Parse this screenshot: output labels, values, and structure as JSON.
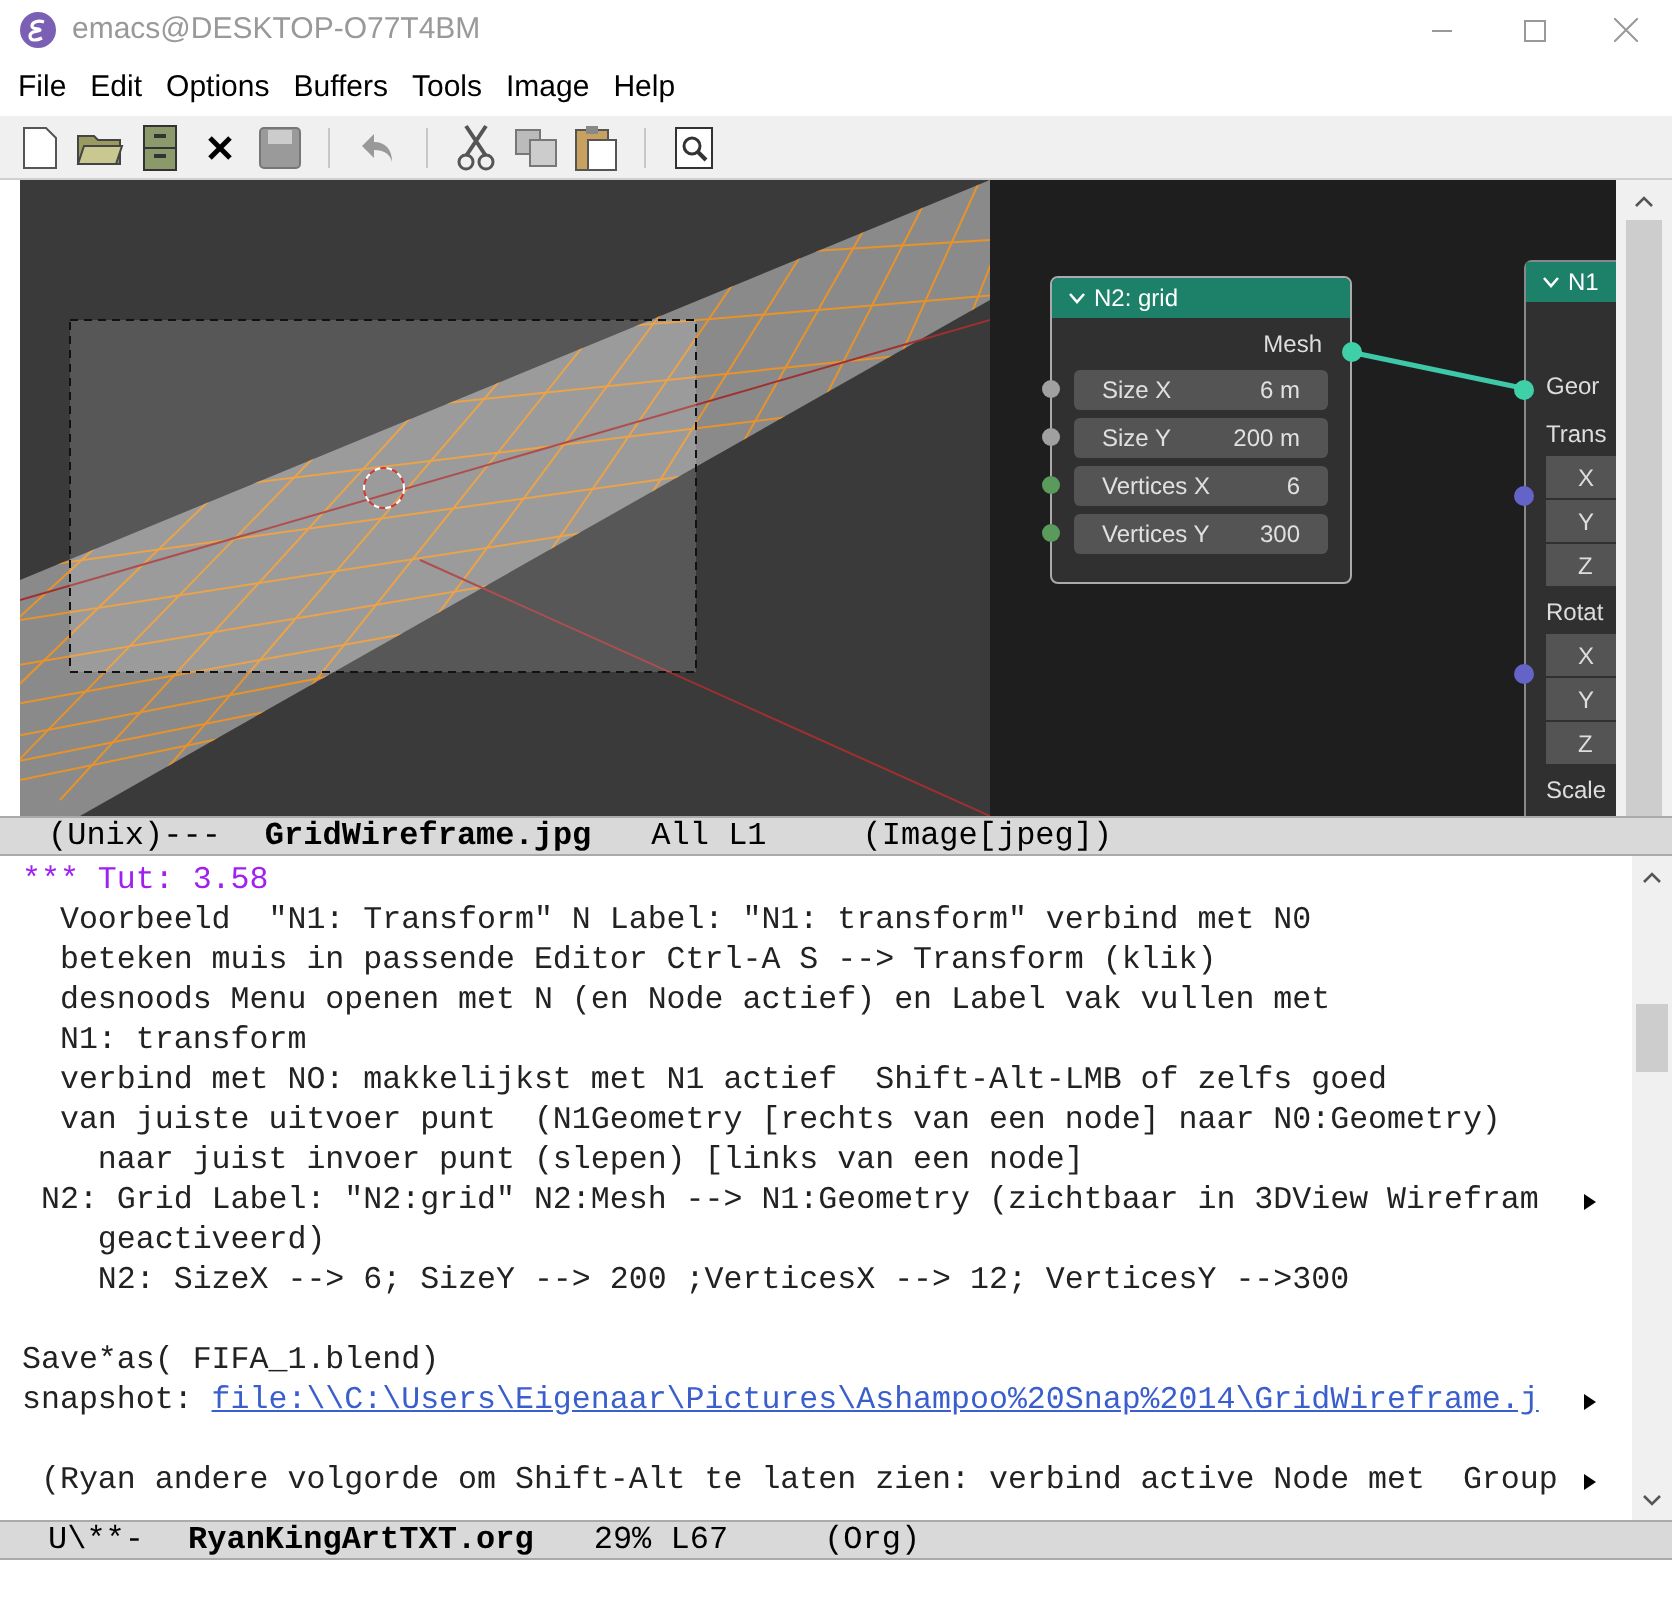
{
  "window": {
    "title": "emacs@DESKTOP-O77T4BM"
  },
  "menu": [
    "File",
    "Edit",
    "Options",
    "Buffers",
    "Tools",
    "Image",
    "Help"
  ],
  "image_pane": {
    "nodes": [
      {
        "title": "N2: grid",
        "output": "Mesh",
        "fields": [
          {
            "label": "Size X",
            "value": "6 m",
            "color": "#a0a0a0"
          },
          {
            "label": "Size Y",
            "value": "200 m",
            "color": "#a0a0a0"
          },
          {
            "label": "Vertices X",
            "value": "6",
            "color": "#5a9a5a"
          },
          {
            "label": "Vertices Y",
            "value": "300",
            "color": "#5a9a5a"
          }
        ]
      },
      {
        "title": "N1",
        "input": "Geor",
        "groups": [
          {
            "label": "Trans",
            "axes": [
              "X",
              "Y",
              "Z"
            ]
          },
          {
            "label": "Rotat",
            "axes": [
              "X",
              "Y",
              "Z"
            ]
          },
          {
            "label": "Scale"
          }
        ]
      }
    ]
  },
  "image_mode_line": {
    "prefix": "(Unix)---",
    "buffer": "GridWireframe.jpg",
    "position": "All L1",
    "mode": "(Image[jpeg])"
  },
  "lines": [
    {
      "kind": "heading",
      "text": "*** Tut: 3.58"
    },
    {
      "kind": "text",
      "text": "  Voorbeeld  \"N1: Transform\" N Label: \"N1: transform\" verbind met N0"
    },
    {
      "kind": "text",
      "text": "  beteken muis in passende Editor Ctrl-A S --> Transform (klik)"
    },
    {
      "kind": "text",
      "text": "  desnoods Menu openen met N (en Node actief) en Label vak vullen met"
    },
    {
      "kind": "text",
      "text": "  N1: transform"
    },
    {
      "kind": "text",
      "text": "  verbind met NO: makkelijkst met N1 actief  Shift-Alt-LMB of zelfs goed"
    },
    {
      "kind": "text",
      "text": "  van juiste uitvoer punt  (N1Geometry [rechts van een node] naar N0:Geometry)"
    },
    {
      "kind": "text",
      "text": "    naar juist invoer punt (slepen) [links van een node]"
    },
    {
      "kind": "text",
      "text": " N2: Grid Label: \"N2:grid\" N2:Mesh --> N1:Geometry (zichtbaar in 3DView Wirefram",
      "continued": true
    },
    {
      "kind": "text",
      "text": "    geactiveerd)"
    },
    {
      "kind": "text",
      "text": "    N2: SizeX --> 6; SizeY --> 200 ;VerticesX --> 12; VerticesY -->300"
    },
    {
      "kind": "blank"
    },
    {
      "kind": "text",
      "text": "Save*as( FIFA_1.blend)"
    },
    {
      "kind": "link",
      "text": "snapshot: ",
      "link": "file:\\\\C:\\Users\\Eigenaar\\Pictures\\Ashampoo%20Snap%2014\\GridWireframe.j",
      "continued": true
    },
    {
      "kind": "blank"
    },
    {
      "kind": "text",
      "text": " (Ryan andere volgorde om Shift-Alt te laten zien: verbind active Node met  Group",
      "continued": true
    }
  ],
  "text_mode_line": {
    "prefix": "U\\**-",
    "buffer": "RyanKingArtTXT.org",
    "position": "29% L67",
    "mode": "(Org)"
  }
}
